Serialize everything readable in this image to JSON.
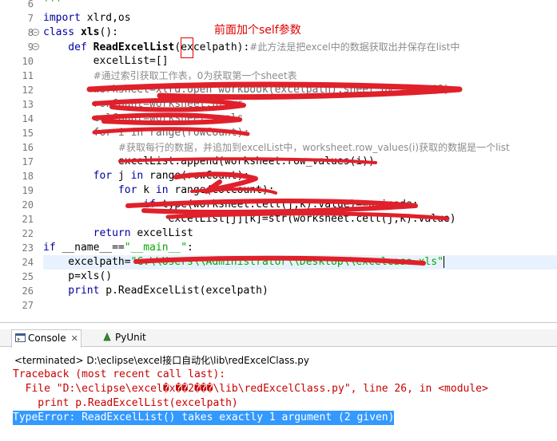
{
  "editor": {
    "annotation": "前面加个self参数",
    "lines": [
      {
        "num": "6",
        "fold": "",
        "tokens": [
          {
            "t": "'''",
            "c": "str"
          }
        ]
      },
      {
        "num": "7",
        "fold": "",
        "tokens": [
          {
            "t": "import",
            "c": "kw"
          },
          {
            "t": " xlrd,os",
            "c": ""
          }
        ]
      },
      {
        "num": "8",
        "fold": "⊖",
        "tokens": [
          {
            "t": "class",
            "c": "kw"
          },
          {
            "t": " ",
            "c": ""
          },
          {
            "t": "xls",
            "c": "fn"
          },
          {
            "t": "():",
            "c": ""
          }
        ]
      },
      {
        "num": "9",
        "fold": "⊖",
        "tokens": [
          {
            "t": "    def",
            "c": "kw"
          },
          {
            "t": " ",
            "c": ""
          },
          {
            "t": "ReadExcelList",
            "c": "fn"
          },
          {
            "t": "(excelpath):",
            "c": ""
          },
          {
            "t": "#此方法是把excel中的数据获取出并保存在list中",
            "c": "cm"
          }
        ]
      },
      {
        "num": "10",
        "fold": "",
        "tokens": [
          {
            "t": "        excelList=[]",
            "c": ""
          }
        ]
      },
      {
        "num": "11",
        "fold": "",
        "tokens": [
          {
            "t": "        ",
            "c": ""
          },
          {
            "t": "#通过索引获取工作表，0为获取第一个sheet表",
            "c": "cm"
          }
        ]
      },
      {
        "num": "12",
        "fold": "",
        "tokens": [
          {
            "t": "        worksheet=xlrd.open_workbook(excelpath).sheet_by_index(0)",
            "c": "strike"
          }
        ]
      },
      {
        "num": "13",
        "fold": "",
        "tokens": [
          {
            "t": "        rowCount=worksheet.nrows",
            "c": "strike"
          }
        ]
      },
      {
        "num": "14",
        "fold": "",
        "tokens": [
          {
            "t": "        colCount=worksheet.ncols",
            "c": "strike"
          }
        ]
      },
      {
        "num": "15",
        "fold": "",
        "tokens": [
          {
            "t": "        for i in range(rowCount):",
            "c": "strike"
          }
        ]
      },
      {
        "num": "16",
        "fold": "",
        "tokens": [
          {
            "t": "            ",
            "c": ""
          },
          {
            "t": "#获取每行的数据，并追加到excelList中，worksheet.row_values(i)获取的数据是一个list",
            "c": "cm"
          }
        ]
      },
      {
        "num": "17",
        "fold": "",
        "tokens": [
          {
            "t": "            excelList.append(worksheet.row_values(i))",
            "c": ""
          }
        ]
      },
      {
        "num": "18",
        "fold": "",
        "tokens": [
          {
            "t": "        for",
            "c": "kw"
          },
          {
            "t": " j ",
            "c": ""
          },
          {
            "t": "in",
            "c": "kw"
          },
          {
            "t": " range(rowCount):",
            "c": ""
          }
        ]
      },
      {
        "num": "19",
        "fold": "",
        "tokens": [
          {
            "t": "            for",
            "c": "kw"
          },
          {
            "t": " k ",
            "c": ""
          },
          {
            "t": "in",
            "c": "kw"
          },
          {
            "t": " range(colCount):",
            "c": ""
          }
        ]
      },
      {
        "num": "20",
        "fold": "",
        "tokens": [
          {
            "t": "                if",
            "c": "kw"
          },
          {
            "t": " type(worksheet.cell(j,k).value)==unicode:",
            "c": ""
          }
        ]
      },
      {
        "num": "21",
        "fold": "",
        "tokens": [
          {
            "t": "                    excelList[j][k]=str(worksheet.cell(j,k).value)",
            "c": ""
          }
        ]
      },
      {
        "num": "22",
        "fold": "",
        "tokens": [
          {
            "t": "        return",
            "c": "kw"
          },
          {
            "t": " excelList",
            "c": ""
          }
        ]
      },
      {
        "num": "23",
        "fold": "",
        "tokens": [
          {
            "t": "if",
            "c": "kw"
          },
          {
            "t": " __name__==",
            "c": ""
          },
          {
            "t": "\"__main__\"",
            "c": "str"
          },
          {
            "t": ":",
            "c": ""
          }
        ]
      },
      {
        "num": "24",
        "fold": "",
        "tokens": [
          {
            "t": "    excelpath=",
            "c": ""
          },
          {
            "t": "\"C:\\\\Users\\\\Administrator\\\\Desktop\\\\excelcase.xls\"",
            "c": "str"
          }
        ]
      },
      {
        "num": "25",
        "fold": "",
        "tokens": [
          {
            "t": "    p=xls()",
            "c": ""
          }
        ]
      },
      {
        "num": "26",
        "fold": "",
        "tokens": [
          {
            "t": "    print",
            "c": "kw"
          },
          {
            "t": " p.ReadExcelList(excelpath)",
            "c": ""
          }
        ]
      },
      {
        "num": "27",
        "fold": "",
        "tokens": []
      }
    ]
  },
  "console": {
    "tabs": [
      {
        "label": "Console",
        "icon": "console-icon",
        "active": true
      },
      {
        "label": "PyUnit",
        "icon": "pyunit-icon",
        "active": false
      }
    ],
    "close_glyph": "✕",
    "status": "<terminated> D:\\eclipse\\excel接口自动化\\lib\\redExcelClass.py",
    "output": [
      "Traceback (most recent call last):",
      "  File \"D:\\eclipse\\excel�x��2���\\lib\\redExcelClass.py\", line 26, in <module>",
      "    print p.ReadExcelList(excelpath)",
      "TypeError: ReadExcelList() takes exactly 1 argument (2 given)"
    ]
  },
  "colors": {
    "annotation_red": "#e00000",
    "scribble_red": "#e0202a",
    "keyword_blue": "#0000a0",
    "comment_gray": "#8c8c8c",
    "string_green": "#00aa00",
    "error_red": "#c80000",
    "selection_blue": "#3399ff",
    "current_line": "#e8f2fe"
  }
}
